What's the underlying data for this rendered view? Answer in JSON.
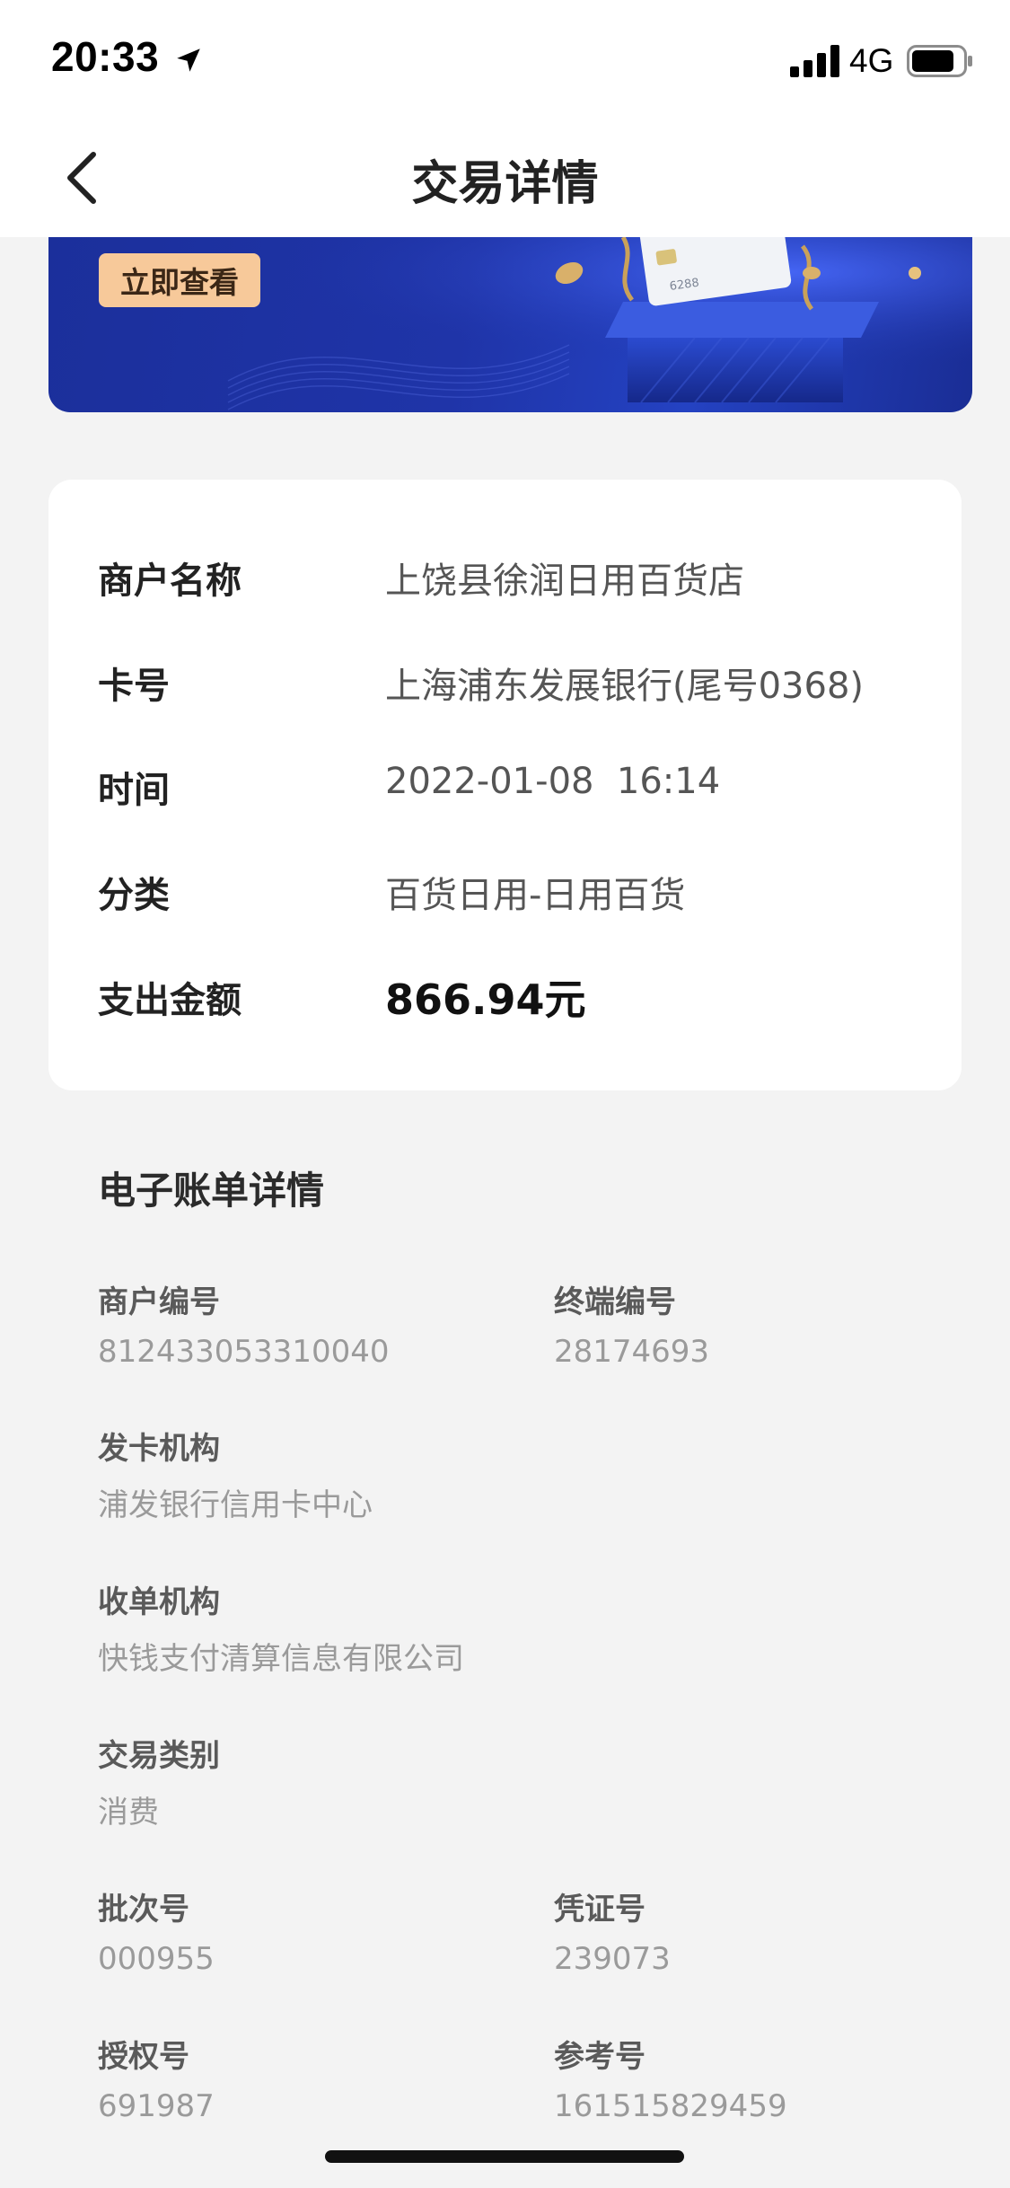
{
  "status_bar": {
    "time": "20:33",
    "network": "4G",
    "icons": [
      "location-arrow-icon",
      "cellular-signal-icon",
      "battery-icon"
    ]
  },
  "nav": {
    "title": "交易详情",
    "back_icon": "chevron-left-icon"
  },
  "banner": {
    "button_label": "立即查看",
    "card_text": "6288",
    "colors": {
      "background": "#1f34a8",
      "button": "#f7c99a"
    }
  },
  "summary": {
    "rows": [
      {
        "label": "商户名称",
        "value": "上饶县徐润日用百货店"
      },
      {
        "label": "卡号",
        "value": "上海浦东发展银行(尾号0368)"
      },
      {
        "label": "时间",
        "value": "2022-01-08  16:14"
      },
      {
        "label": "分类",
        "value": "百货日用-日用百货"
      },
      {
        "label": "支出金额",
        "value": "866.94元"
      }
    ]
  },
  "ebill": {
    "title": "电子账单详情",
    "merchant_no": {
      "label": "商户编号",
      "value": "812433053310040"
    },
    "terminal_no": {
      "label": "终端编号",
      "value": "28174693"
    },
    "issuer": {
      "label": "发卡机构",
      "value": "浦发银行信用卡中心"
    },
    "acquirer": {
      "label": "收单机构",
      "value": "快钱支付清算信息有限公司"
    },
    "txn_type": {
      "label": "交易类别",
      "value": "消费"
    },
    "batch_no": {
      "label": "批次号",
      "value": "000955"
    },
    "voucher_no": {
      "label": "凭证号",
      "value": "239073"
    },
    "auth_no": {
      "label": "授权号",
      "value": "691987"
    },
    "ref_no": {
      "label": "参考号",
      "value": "161515829459"
    }
  }
}
